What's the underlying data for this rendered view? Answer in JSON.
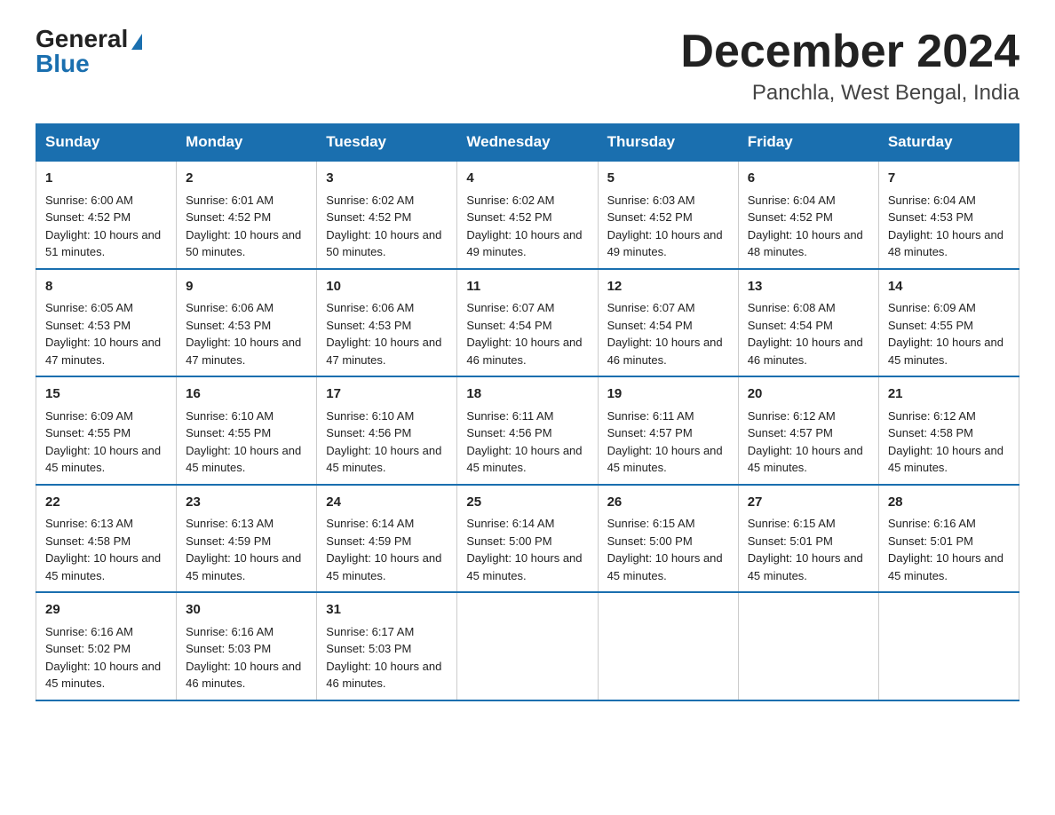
{
  "logo": {
    "general": "General",
    "blue": "Blue"
  },
  "title": "December 2024",
  "subtitle": "Panchla, West Bengal, India",
  "days_of_week": [
    "Sunday",
    "Monday",
    "Tuesday",
    "Wednesday",
    "Thursday",
    "Friday",
    "Saturday"
  ],
  "weeks": [
    [
      {
        "day": "1",
        "sunrise": "6:00 AM",
        "sunset": "4:52 PM",
        "daylight": "10 hours and 51 minutes."
      },
      {
        "day": "2",
        "sunrise": "6:01 AM",
        "sunset": "4:52 PM",
        "daylight": "10 hours and 50 minutes."
      },
      {
        "day": "3",
        "sunrise": "6:02 AM",
        "sunset": "4:52 PM",
        "daylight": "10 hours and 50 minutes."
      },
      {
        "day": "4",
        "sunrise": "6:02 AM",
        "sunset": "4:52 PM",
        "daylight": "10 hours and 49 minutes."
      },
      {
        "day": "5",
        "sunrise": "6:03 AM",
        "sunset": "4:52 PM",
        "daylight": "10 hours and 49 minutes."
      },
      {
        "day": "6",
        "sunrise": "6:04 AM",
        "sunset": "4:52 PM",
        "daylight": "10 hours and 48 minutes."
      },
      {
        "day": "7",
        "sunrise": "6:04 AM",
        "sunset": "4:53 PM",
        "daylight": "10 hours and 48 minutes."
      }
    ],
    [
      {
        "day": "8",
        "sunrise": "6:05 AM",
        "sunset": "4:53 PM",
        "daylight": "10 hours and 47 minutes."
      },
      {
        "day": "9",
        "sunrise": "6:06 AM",
        "sunset": "4:53 PM",
        "daylight": "10 hours and 47 minutes."
      },
      {
        "day": "10",
        "sunrise": "6:06 AM",
        "sunset": "4:53 PM",
        "daylight": "10 hours and 47 minutes."
      },
      {
        "day": "11",
        "sunrise": "6:07 AM",
        "sunset": "4:54 PM",
        "daylight": "10 hours and 46 minutes."
      },
      {
        "day": "12",
        "sunrise": "6:07 AM",
        "sunset": "4:54 PM",
        "daylight": "10 hours and 46 minutes."
      },
      {
        "day": "13",
        "sunrise": "6:08 AM",
        "sunset": "4:54 PM",
        "daylight": "10 hours and 46 minutes."
      },
      {
        "day": "14",
        "sunrise": "6:09 AM",
        "sunset": "4:55 PM",
        "daylight": "10 hours and 45 minutes."
      }
    ],
    [
      {
        "day": "15",
        "sunrise": "6:09 AM",
        "sunset": "4:55 PM",
        "daylight": "10 hours and 45 minutes."
      },
      {
        "day": "16",
        "sunrise": "6:10 AM",
        "sunset": "4:55 PM",
        "daylight": "10 hours and 45 minutes."
      },
      {
        "day": "17",
        "sunrise": "6:10 AM",
        "sunset": "4:56 PM",
        "daylight": "10 hours and 45 minutes."
      },
      {
        "day": "18",
        "sunrise": "6:11 AM",
        "sunset": "4:56 PM",
        "daylight": "10 hours and 45 minutes."
      },
      {
        "day": "19",
        "sunrise": "6:11 AM",
        "sunset": "4:57 PM",
        "daylight": "10 hours and 45 minutes."
      },
      {
        "day": "20",
        "sunrise": "6:12 AM",
        "sunset": "4:57 PM",
        "daylight": "10 hours and 45 minutes."
      },
      {
        "day": "21",
        "sunrise": "6:12 AM",
        "sunset": "4:58 PM",
        "daylight": "10 hours and 45 minutes."
      }
    ],
    [
      {
        "day": "22",
        "sunrise": "6:13 AM",
        "sunset": "4:58 PM",
        "daylight": "10 hours and 45 minutes."
      },
      {
        "day": "23",
        "sunrise": "6:13 AM",
        "sunset": "4:59 PM",
        "daylight": "10 hours and 45 minutes."
      },
      {
        "day": "24",
        "sunrise": "6:14 AM",
        "sunset": "4:59 PM",
        "daylight": "10 hours and 45 minutes."
      },
      {
        "day": "25",
        "sunrise": "6:14 AM",
        "sunset": "5:00 PM",
        "daylight": "10 hours and 45 minutes."
      },
      {
        "day": "26",
        "sunrise": "6:15 AM",
        "sunset": "5:00 PM",
        "daylight": "10 hours and 45 minutes."
      },
      {
        "day": "27",
        "sunrise": "6:15 AM",
        "sunset": "5:01 PM",
        "daylight": "10 hours and 45 minutes."
      },
      {
        "day": "28",
        "sunrise": "6:16 AM",
        "sunset": "5:01 PM",
        "daylight": "10 hours and 45 minutes."
      }
    ],
    [
      {
        "day": "29",
        "sunrise": "6:16 AM",
        "sunset": "5:02 PM",
        "daylight": "10 hours and 45 minutes."
      },
      {
        "day": "30",
        "sunrise": "6:16 AM",
        "sunset": "5:03 PM",
        "daylight": "10 hours and 46 minutes."
      },
      {
        "day": "31",
        "sunrise": "6:17 AM",
        "sunset": "5:03 PM",
        "daylight": "10 hours and 46 minutes."
      },
      {
        "day": "",
        "sunrise": "",
        "sunset": "",
        "daylight": ""
      },
      {
        "day": "",
        "sunrise": "",
        "sunset": "",
        "daylight": ""
      },
      {
        "day": "",
        "sunrise": "",
        "sunset": "",
        "daylight": ""
      },
      {
        "day": "",
        "sunrise": "",
        "sunset": "",
        "daylight": ""
      }
    ]
  ]
}
